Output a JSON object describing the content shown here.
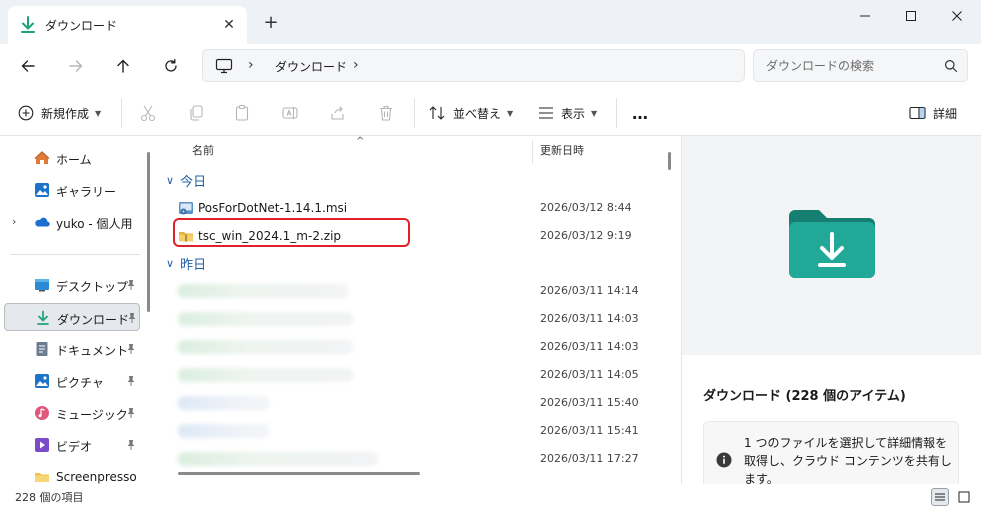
{
  "window": {
    "tab_title": "ダウンロード",
    "tab_close": "✕",
    "new_tab": "+"
  },
  "address": {
    "separator": "›",
    "crumb": "ダウンロード",
    "search_placeholder": "ダウンロードの検索"
  },
  "toolbar": {
    "new_label": "新規作成",
    "sort_label": "並べ替え",
    "view_label": "表示",
    "more": "…",
    "details_label": "詳細"
  },
  "sidebar": {
    "items": [
      {
        "label": "ホーム",
        "icon": "home-icon"
      },
      {
        "label": "ギャラリー",
        "icon": "gallery-icon"
      },
      {
        "label": "yuko - 個人用",
        "icon": "onedrive-icon"
      },
      {
        "label": "デスクトップ",
        "icon": "desktop-icon",
        "pinned": true
      },
      {
        "label": "ダウンロード",
        "icon": "download-icon",
        "pinned": true,
        "selected": true
      },
      {
        "label": "ドキュメント",
        "icon": "documents-icon",
        "pinned": true
      },
      {
        "label": "ピクチャ",
        "icon": "pictures-icon",
        "pinned": true
      },
      {
        "label": "ミュージック",
        "icon": "music-icon",
        "pinned": true
      },
      {
        "label": "ビデオ",
        "icon": "videos-icon",
        "pinned": true
      },
      {
        "label": "Screenpresso",
        "icon": "folder-icon"
      }
    ]
  },
  "filelist": {
    "col_name": "名前",
    "col_date": "更新日時",
    "sort_indicator": "^",
    "groups": [
      {
        "label": "今日",
        "rows": [
          {
            "name": "PosForDotNet-1.14.1.msi",
            "date": "2026/03/12 8:44",
            "icon": "msi-icon"
          },
          {
            "name": "tsc_win_2024.1_m-2.zip",
            "date": "2026/03/12 9:19",
            "icon": "zip-folder-icon",
            "highlighted": true
          }
        ]
      },
      {
        "label": "昨日",
        "rows": [
          {
            "name": "",
            "date": "2026/03/11 14:14"
          },
          {
            "name": "",
            "date": "2026/03/11 14:03"
          },
          {
            "name": "",
            "date": "2026/03/11 14:03"
          },
          {
            "name": "",
            "date": "2026/03/11 14:05"
          },
          {
            "name": "",
            "date": "2026/03/11 15:40"
          },
          {
            "name": "",
            "date": "2026/03/11 15:41"
          },
          {
            "name": "",
            "date": "2026/03/11 17:27"
          }
        ]
      }
    ]
  },
  "details": {
    "title": "ダウンロード (228 個のアイテム)",
    "info_text": "1 つのファイルを選択して詳細情報を取得し、クラウド コンテンツを共有します。"
  },
  "status": {
    "count": "228 個の項目"
  },
  "colors": {
    "accent": "#1f5fa8",
    "highlight_border": "#e0202a",
    "folder_teal": "#1e9f8f"
  }
}
